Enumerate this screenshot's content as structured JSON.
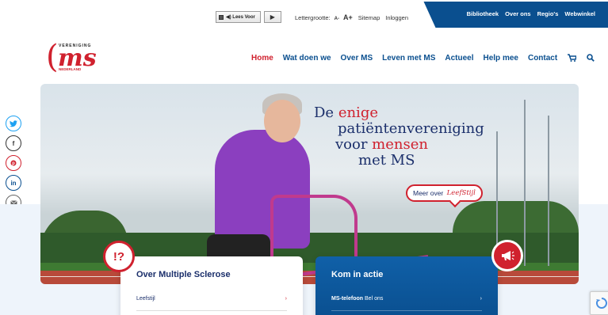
{
  "topbar": {
    "readspeaker_label": "◀) Lees Voor",
    "play_symbol": "▶",
    "fontsize_label": "Lettergrootte:",
    "fontsize_small": "A-",
    "fontsize_large": "A+",
    "sitemap": "Sitemap",
    "login": "Inloggen"
  },
  "secondary_nav": [
    "Bibliotheek",
    "Over ons",
    "Regio's",
    "Webwinkel"
  ],
  "logo": {
    "top_text": "VERENIGING",
    "main": "ms",
    "bottom_text": "NEDERLAND"
  },
  "main_nav": {
    "items": [
      "Home",
      "Wat doen we",
      "Over MS",
      "Leven met MS",
      "Actueel",
      "Help mee",
      "Contact"
    ],
    "active": "Home",
    "cart_icon": "cart-icon",
    "search_icon": "search-icon"
  },
  "social": [
    {
      "name": "twitter-icon",
      "glyph": "🐦"
    },
    {
      "name": "facebook-icon",
      "glyph": "f"
    },
    {
      "name": "pinterest-icon",
      "glyph": "℗"
    },
    {
      "name": "linkedin-icon",
      "glyph": "in"
    },
    {
      "name": "email-icon",
      "glyph": "✉"
    }
  ],
  "hero": {
    "headline_1a": "De ",
    "headline_1b": "enige",
    "headline_2": "patiëntenvereniging",
    "headline_3a": "voor ",
    "headline_3b": "mensen",
    "headline_4": "met MS",
    "cta_prefix": "Meer over",
    "cta_highlight": "LeefStijl"
  },
  "cards": [
    {
      "title": "Over Multiple Sclerose",
      "row_label": "Leefstijl",
      "row_label_bold": "",
      "chevron": "›",
      "badge": "!?"
    },
    {
      "title": "Kom in actie",
      "row_label": "Bel ons",
      "row_label_bold": "MS-telefoon",
      "chevron": "›",
      "badge": "📣"
    }
  ],
  "colors": {
    "brand_red": "#d0212e",
    "brand_blue": "#0a4f8f",
    "navy_text": "#1b2f6b"
  }
}
